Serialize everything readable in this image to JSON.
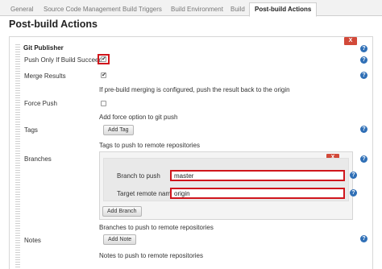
{
  "tabs": [
    {
      "label": "General"
    },
    {
      "label": "Source Code Management"
    },
    {
      "label": "Build Triggers"
    },
    {
      "label": "Build Environment"
    },
    {
      "label": "Build"
    },
    {
      "label": "Post-build Actions"
    }
  ],
  "page_title": "Post-build Actions",
  "publisher": {
    "title": "Git Publisher",
    "delete_label": "X",
    "push_only_if_success": {
      "label": "Push Only If Build Succeeds",
      "checked": true
    },
    "merge_results": {
      "label": "Merge Results",
      "checked": true,
      "description": "If pre-build merging is configured, push the result back to the origin"
    },
    "force_push": {
      "label": "Force Push",
      "checked": false,
      "description": "Add force option to git push"
    },
    "tags": {
      "label": "Tags",
      "button": "Add Tag",
      "description": "Tags to push to remote repositories"
    },
    "branches": {
      "label": "Branches",
      "delete_label": "X",
      "branch_to_push_label": "Branch to push",
      "branch_to_push_value": "master",
      "target_remote_label": "Target remote name",
      "target_remote_value": "origin",
      "button": "Add Branch",
      "description": "Branches to push to remote repositories"
    },
    "notes": {
      "label": "Notes",
      "button": "Add Note",
      "description": "Notes to push to remote repositories"
    }
  },
  "help_icon_glyph": "?",
  "check_glyph": "✔",
  "colors": {
    "highlight": "#d0161c",
    "delete": "#d24939",
    "help": "#2f6fb6"
  }
}
